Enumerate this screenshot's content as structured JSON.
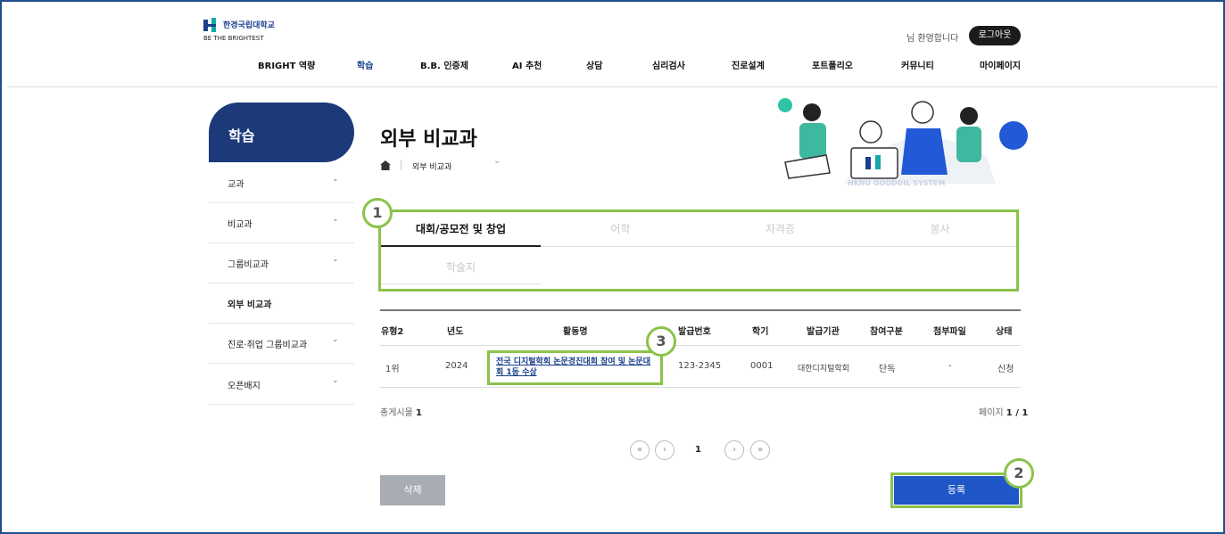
{
  "header": {
    "logo_name": "한경국립대학교",
    "logo_tagline": "BE THE BRIGHTEST",
    "welcome": "님 환영합니다",
    "logout_label": "로그아웃",
    "nav": [
      "BRIGHT 역량",
      "학습",
      "B.B. 인증제",
      "AI 추천",
      "상담",
      "심리검사",
      "진로설계",
      "포트폴리오",
      "커뮤니티",
      "마이페이지"
    ],
    "nav_active_index": 1
  },
  "sidebar": {
    "title": "학습",
    "items": [
      {
        "label": "교과",
        "has_submenu": true
      },
      {
        "label": "비교과",
        "has_submenu": true
      },
      {
        "label": "그룹비교과",
        "has_submenu": true
      },
      {
        "label": "외부 비교과",
        "has_submenu": false,
        "current": true
      },
      {
        "label": "진로·취업 그룹비교과",
        "has_submenu": true
      },
      {
        "label": "오픈배지",
        "has_submenu": true
      }
    ]
  },
  "page": {
    "title": "외부 비교과",
    "breadcrumb": "외부 비교과",
    "illustration_text": "HKNU GOODGIL SYSTEM"
  },
  "tabs": [
    {
      "label": "대회/공모전 및 창업",
      "active": true
    },
    {
      "label": "어학",
      "active": false
    },
    {
      "label": "자격증",
      "active": false
    },
    {
      "label": "봉사",
      "active": false
    },
    {
      "label": "학술지",
      "active": false
    }
  ],
  "table": {
    "columns": [
      "유형2",
      "년도",
      "활동명",
      "발급번호",
      "학기",
      "발급기관",
      "참여구분",
      "첨부파일",
      "상태"
    ],
    "rows": [
      {
        "type2": "1위",
        "year": "2024",
        "activity": "전국 디지털학회 논문경진대회 참여 및 논문대회 1등 수상",
        "issue_no": "123-2345",
        "semester": "0001",
        "issuer": "대한디지털학회",
        "participation": "단독",
        "attachment": "-",
        "status": "신청"
      }
    ]
  },
  "summary": {
    "total_label": "총게시물",
    "total_count": "1",
    "page_label": "페이지",
    "page_value": "1 / 1"
  },
  "pagination": {
    "first": "«",
    "prev": "‹",
    "current": "1",
    "next": "›",
    "last": "»"
  },
  "actions": {
    "delete_label": "삭제",
    "register_label": "등록"
  },
  "annotations": [
    "1",
    "2",
    "3"
  ],
  "colors": {
    "accent": "#1f56c8",
    "sidebar_head": "#1c3a7a",
    "highlight": "#8bc34a",
    "delete_button": "#a8adb4"
  }
}
